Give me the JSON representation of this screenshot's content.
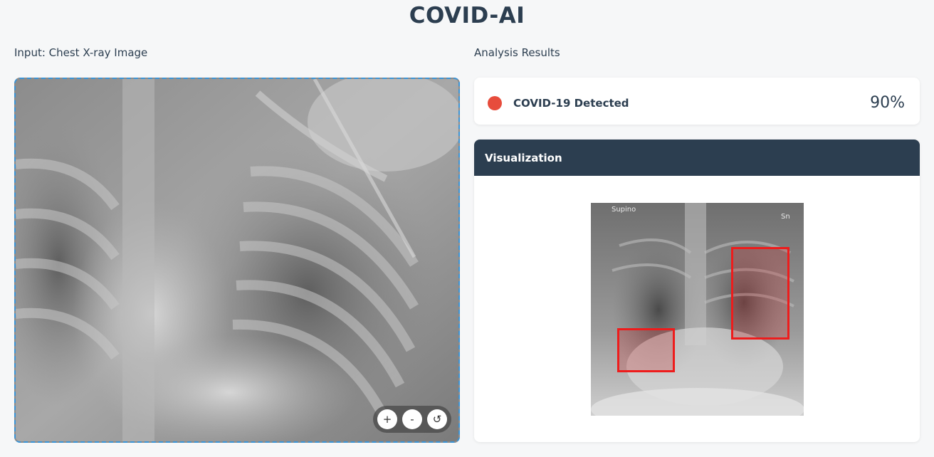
{
  "app": {
    "title": "COVID-AI"
  },
  "input_panel": {
    "label": "Input: Chest X-ray Image",
    "controls": {
      "zoom_in": "+",
      "zoom_out": "-",
      "reset": "↺"
    }
  },
  "results_panel": {
    "label": "Analysis Results",
    "diagnosis": "COVID-19 Detected",
    "confidence": "90%",
    "status_color": "#e74c3c"
  },
  "visualization": {
    "header": "Visualization",
    "image_tags": {
      "left": "Supino",
      "right": "Sn"
    },
    "highlight_color": "#ee1c1c"
  },
  "theme": {
    "primary": "#2c3e50",
    "accent": "#3a93d5",
    "background": "#f6f7f8"
  }
}
